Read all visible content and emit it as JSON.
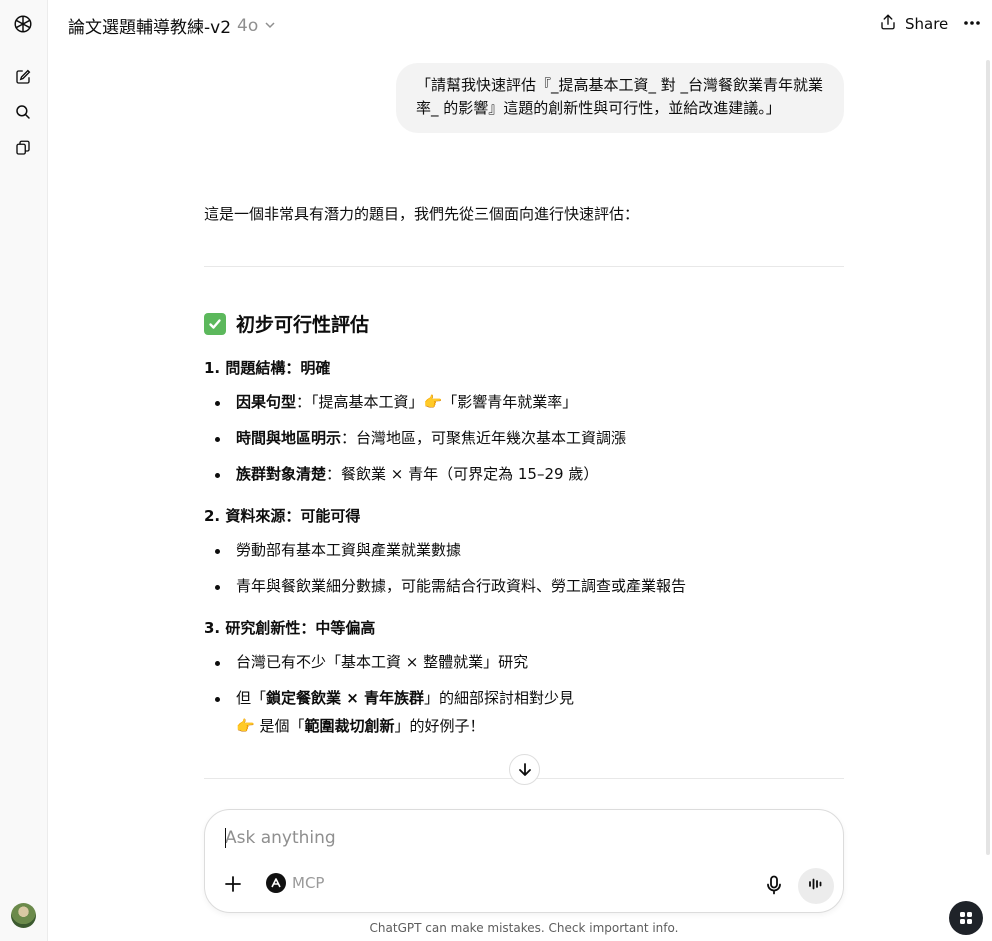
{
  "header": {
    "title": "論文選題輔導教練-v2",
    "model": "4o",
    "share_label": "Share"
  },
  "sidebar": {
    "icons": [
      "openai-logo-icon",
      "new-chat-icon",
      "search-icon",
      "library-icon"
    ]
  },
  "conversation": {
    "user_message": "「請幫我快速評估『_提高基本工資_ 對 _台灣餐飲業青年就業率_ 的影響』這題的創新性與可行性，並給改進建議。」",
    "assistant": {
      "intro": "這是一個非常具有潛力的題目，我們先從三個面向進行快速評估：",
      "heading": "初步可行性評估",
      "sections": [
        {
          "title": "1. 問題結構：明確",
          "items": [
            {
              "bold": "因果句型",
              "text": "：「提高基本工資」👉「影響青年就業率」"
            },
            {
              "bold": "時間與地區明示",
              "text": "：台灣地區，可聚焦近年幾次基本工資調漲"
            },
            {
              "bold": "族群對象清楚",
              "text": "：餐飲業 × 青年（可界定為 15–29 歲）"
            }
          ]
        },
        {
          "title": "2. 資料來源：可能可得",
          "items": [
            {
              "bold": "",
              "text": "勞動部有基本工資與產業就業數據"
            },
            {
              "bold": "",
              "text": "青年與餐飲業細分數據，可能需結合行政資料、勞工調查或產業報告"
            }
          ]
        },
        {
          "title": "3. 研究創新性：中等偏高",
          "items": [
            {
              "text_pre": "台灣已有不少「基本工資 × 整體就業」研究"
            },
            {
              "text_pre": "但「",
              "bold": "鎖定餐飲業 × 青年族群",
              "text_post": "」的細部探討相對少見"
            }
          ],
          "followup": {
            "pre": "👉 是個「",
            "bold": "範圍裁切創新",
            "post": "」的好例子！"
          }
        }
      ]
    }
  },
  "composer": {
    "placeholder": "Ask anything",
    "tool_label": "MCP"
  },
  "footer": {
    "disclaimer": "ChatGPT can make mistakes. Check important info."
  }
}
